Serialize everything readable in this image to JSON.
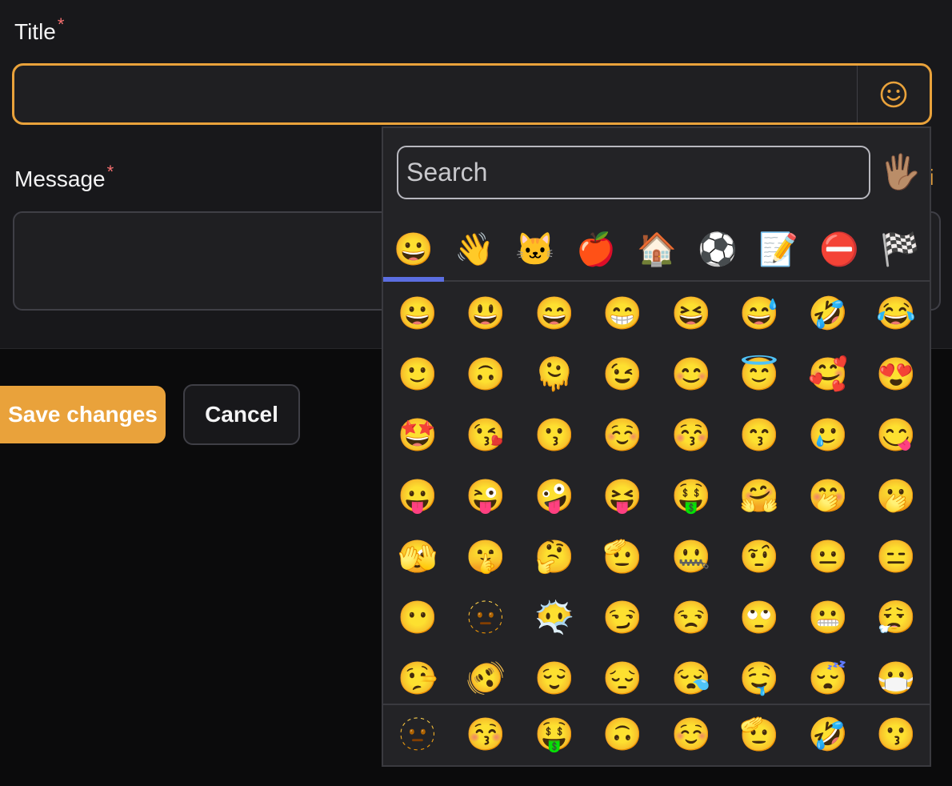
{
  "form": {
    "title_label": "Title",
    "message_label": "Message",
    "required_mark": "*",
    "gif_hint": "ji",
    "save_label": "Save changes",
    "cancel_label": "Cancel",
    "colors": {
      "accent": "#e9a23b",
      "required": "#f87171"
    }
  },
  "picker": {
    "search_placeholder": "Search",
    "skin_tone": "🖐🏽",
    "categories": [
      "😀",
      "👋",
      "🐱",
      "🍎",
      "🏠",
      "⚽",
      "📝",
      "⛔",
      "🏁"
    ],
    "active_category_index": 0,
    "grid": [
      [
        "😀",
        "😃",
        "😄",
        "😁",
        "😆",
        "😅",
        "🤣",
        "😂"
      ],
      [
        "🙂",
        "🙃",
        "🫠",
        "😉",
        "😊",
        "😇",
        "🥰",
        "😍"
      ],
      [
        "🤩",
        "😘",
        "😗",
        "☺️",
        "😚",
        "😙",
        "🥲",
        "😋"
      ],
      [
        "😛",
        "😜",
        "🤪",
        "😝",
        "🤑",
        "🤗",
        "🤭",
        "🫢"
      ],
      [
        "🫣",
        "🤫",
        "🤔",
        "🫡",
        "🤐",
        "🤨",
        "😐",
        "😑"
      ],
      [
        "😶",
        "🫥",
        "😶‍🌫️",
        "😏",
        "😒",
        "🙄",
        "😬",
        "😮‍💨"
      ],
      [
        "🤥",
        "🫨",
        "😌",
        "😔",
        "😪",
        "🤤",
        "😴",
        "😷"
      ]
    ],
    "recent": [
      "🫥",
      "😚",
      "🤑",
      "🙃",
      "☺️",
      "🫡",
      "🤣",
      "😗"
    ],
    "colors": {
      "underline": "#5b6ee1"
    }
  }
}
